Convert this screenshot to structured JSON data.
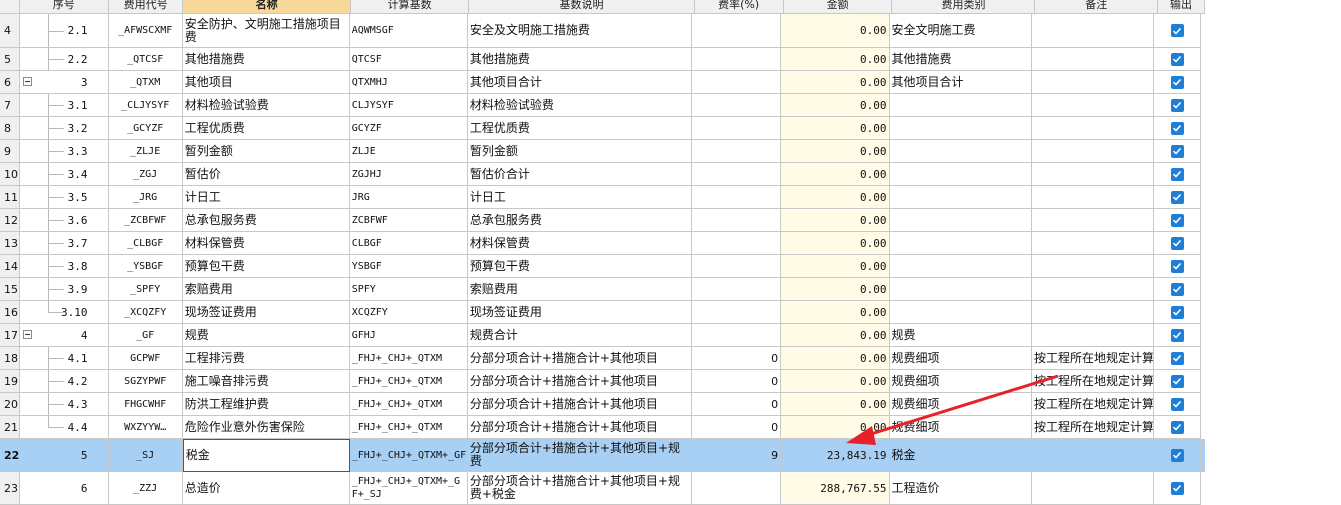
{
  "columns": [
    "序号",
    "费用代号",
    "名称",
    "计算基数",
    "基数说明",
    "费率(%)",
    "金额",
    "费用类别",
    "备注",
    "输出"
  ],
  "rows": [
    {
      "row": "4",
      "seq": "2.1",
      "code": "_AFWSCXMF",
      "name": "安全防护、文明施工措施项目费",
      "base": "AQWMSGF",
      "desc": "安全及文明施工措施费",
      "rate": "",
      "amount": "0.00",
      "type": "安全文明施工费",
      "note": "",
      "checked": true
    },
    {
      "row": "5",
      "seq": "2.2",
      "code": "_QTCSF",
      "name": "其他措施费",
      "base": "QTCSF",
      "desc": "其他措施费",
      "rate": "",
      "amount": "0.00",
      "type": "其他措施费",
      "note": "",
      "checked": true
    },
    {
      "row": "6",
      "seq": "3",
      "code": "_QTXM",
      "name": "其他项目",
      "base": "QTXMHJ",
      "desc": "其他项目合计",
      "rate": "",
      "amount": "0.00",
      "type": "其他项目合计",
      "note": "",
      "checked": true
    },
    {
      "row": "7",
      "seq": "3.1",
      "code": "_CLJYSYF",
      "name": "材料检验试验费",
      "base": "CLJYSYF",
      "desc": "材料检验试验费",
      "rate": "",
      "amount": "0.00",
      "type": "",
      "note": "",
      "checked": true
    },
    {
      "row": "8",
      "seq": "3.2",
      "code": "_GCYZF",
      "name": "工程优质费",
      "base": "GCYZF",
      "desc": "工程优质费",
      "rate": "",
      "amount": "0.00",
      "type": "",
      "note": "",
      "checked": true
    },
    {
      "row": "9",
      "seq": "3.3",
      "code": "_ZLJE",
      "name": "暂列金额",
      "base": "ZLJE",
      "desc": "暂列金额",
      "rate": "",
      "amount": "0.00",
      "type": "",
      "note": "",
      "checked": true
    },
    {
      "row": "10",
      "seq": "3.4",
      "code": "_ZGJ",
      "name": "暂估价",
      "base": "ZGJHJ",
      "desc": "暂估价合计",
      "rate": "",
      "amount": "0.00",
      "type": "",
      "note": "",
      "checked": true
    },
    {
      "row": "11",
      "seq": "3.5",
      "code": "_JRG",
      "name": "计日工",
      "base": "JRG",
      "desc": "计日工",
      "rate": "",
      "amount": "0.00",
      "type": "",
      "note": "",
      "checked": true
    },
    {
      "row": "12",
      "seq": "3.6",
      "code": "_ZCBFWF",
      "name": "总承包服务费",
      "base": "ZCBFWF",
      "desc": "总承包服务费",
      "rate": "",
      "amount": "0.00",
      "type": "",
      "note": "",
      "checked": true
    },
    {
      "row": "13",
      "seq": "3.7",
      "code": "_CLBGF",
      "name": "材料保管费",
      "base": "CLBGF",
      "desc": "材料保管费",
      "rate": "",
      "amount": "0.00",
      "type": "",
      "note": "",
      "checked": true
    },
    {
      "row": "14",
      "seq": "3.8",
      "code": "_YSBGF",
      "name": "预算包干费",
      "base": "YSBGF",
      "desc": "预算包干费",
      "rate": "",
      "amount": "0.00",
      "type": "",
      "note": "",
      "checked": true
    },
    {
      "row": "15",
      "seq": "3.9",
      "code": "_SPFY",
      "name": "索赔费用",
      "base": "SPFY",
      "desc": "索赔费用",
      "rate": "",
      "amount": "0.00",
      "type": "",
      "note": "",
      "checked": true
    },
    {
      "row": "16",
      "seq": "3.10",
      "code": "_XCQZFY",
      "name": "现场签证费用",
      "base": "XCQZFY",
      "desc": "现场签证费用",
      "rate": "",
      "amount": "0.00",
      "type": "",
      "note": "",
      "checked": true
    },
    {
      "row": "17",
      "seq": "4",
      "code": "_GF",
      "name": "规费",
      "base": "GFHJ",
      "desc": "规费合计",
      "rate": "",
      "amount": "0.00",
      "type": "规费",
      "note": "",
      "checked": true
    },
    {
      "row": "18",
      "seq": "4.1",
      "code": "GCPWF",
      "name": "工程排污费",
      "base": "_FHJ+_CHJ+_QTXM",
      "desc": "分部分项合计+措施合计+其他项目",
      "rate": "0",
      "amount": "0.00",
      "type": "规费细项",
      "note": "按工程所在地规定计算",
      "checked": true
    },
    {
      "row": "19",
      "seq": "4.2",
      "code": "SGZYPWF",
      "name": "施工噪音排污费",
      "base": "_FHJ+_CHJ+_QTXM",
      "desc": "分部分项合计+措施合计+其他项目",
      "rate": "0",
      "amount": "0.00",
      "type": "规费细项",
      "note": "按工程所在地规定计算",
      "checked": true
    },
    {
      "row": "20",
      "seq": "4.3",
      "code": "FHGCWHF",
      "name": "防洪工程维护费",
      "base": "_FHJ+_CHJ+_QTXM",
      "desc": "分部分项合计+措施合计+其他项目",
      "rate": "0",
      "amount": "0.00",
      "type": "规费细项",
      "note": "按工程所在地规定计算",
      "checked": true
    },
    {
      "row": "21",
      "seq": "4.4",
      "code": "WXZYYW…",
      "name": "危险作业意外伤害保险",
      "base": "_FHJ+_CHJ+_QTXM",
      "desc": "分部分项合计+措施合计+其他项目",
      "rate": "0",
      "amount": "0.00",
      "type": "规费细项",
      "note": "按工程所在地规定计算",
      "checked": true
    },
    {
      "row": "22",
      "seq": "5",
      "code": "_SJ",
      "name": "税金",
      "base": "_FHJ+_CHJ+_QTXM+_GF",
      "desc": "分部分项合计+措施合计+其他项目+规费",
      "rate": "9",
      "amount": "23,843.19",
      "type": "税金",
      "note": "",
      "checked": true
    },
    {
      "row": "23",
      "seq": "6",
      "code": "_ZZJ",
      "name": "总造价",
      "base": "_FHJ+_CHJ+_QTXM+_GF+_SJ",
      "desc": "分部分项合计+措施合计+其他项目+规费+税金",
      "rate": "",
      "amount": "288,767.55",
      "type": "工程造价",
      "note": "",
      "checked": true
    }
  ],
  "colors": {
    "header_bg": "#f0f0f0",
    "name_header_bg": "#f5d89a",
    "amount_bg": "#fffbe6",
    "selected_bg": "#a8d0f5",
    "checkbox": "#1f7fd6",
    "arrow": "#e8202a"
  }
}
